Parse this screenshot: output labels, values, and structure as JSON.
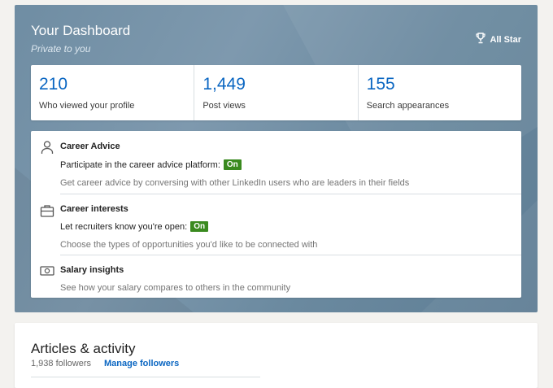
{
  "dashboard": {
    "title": "Your Dashboard",
    "subtitle": "Private to you",
    "badge_label": "All Star",
    "badge_icon": "trophy-icon",
    "stats": [
      {
        "value": "210",
        "label": "Who viewed your profile"
      },
      {
        "value": "1,449",
        "label": "Post views"
      },
      {
        "value": "155",
        "label": "Search appearances"
      }
    ]
  },
  "sections": {
    "career_advice": {
      "icon": "person-icon",
      "title": "Career Advice",
      "line": "Participate in the career advice platform:",
      "status": "On",
      "desc": "Get career advice by conversing with other LinkedIn users who are leaders in their fields"
    },
    "career_interests": {
      "icon": "briefcase-icon",
      "title": "Career interests",
      "line": "Let recruiters know you're open:",
      "status": "On",
      "desc": "Choose the types of opportunities you'd like to be connected with"
    },
    "salary": {
      "icon": "money-icon",
      "title": "Salary insights",
      "desc": "See how your salary compares to others in the community"
    }
  },
  "articles": {
    "title": "Articles & activity",
    "followers": "1,938 followers",
    "manage_link": "Manage followers"
  },
  "colors": {
    "accent": "#0a66c2",
    "status_on": "#3a8a1f",
    "dashboard_bg": "#6f8da3"
  }
}
